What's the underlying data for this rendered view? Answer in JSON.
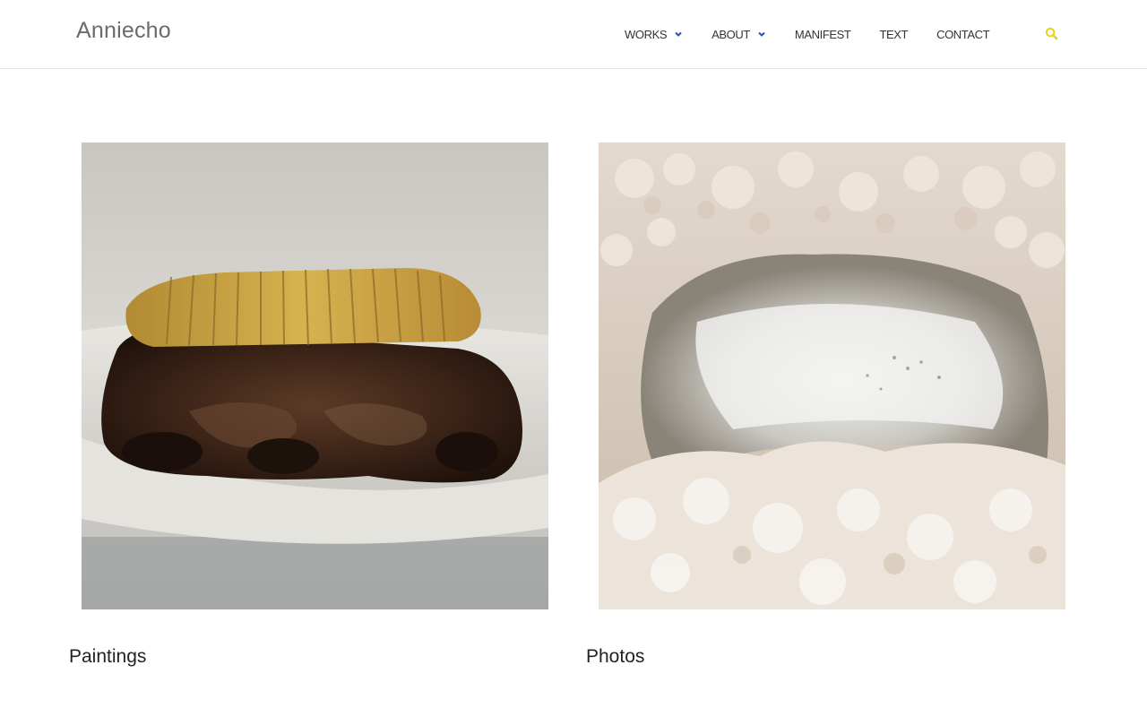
{
  "site": {
    "logo": "Anniecho"
  },
  "nav": {
    "items": [
      {
        "label": "WORKS",
        "has_dropdown": true
      },
      {
        "label": "ABOUT",
        "has_dropdown": true
      },
      {
        "label": "MANIFEST",
        "has_dropdown": false
      },
      {
        "label": "TEXT",
        "has_dropdown": false
      },
      {
        "label": "CONTACT",
        "has_dropdown": false
      }
    ],
    "chevron_color": "#2b4fb3",
    "search_icon": "search-icon",
    "search_color": "#e6d21a"
  },
  "gallery": {
    "cards": [
      {
        "title": "Paintings",
        "image": "painting of meat on a white plate"
      },
      {
        "title": "Photos",
        "image": "photo of salt crystals around a reflective pool"
      }
    ]
  }
}
